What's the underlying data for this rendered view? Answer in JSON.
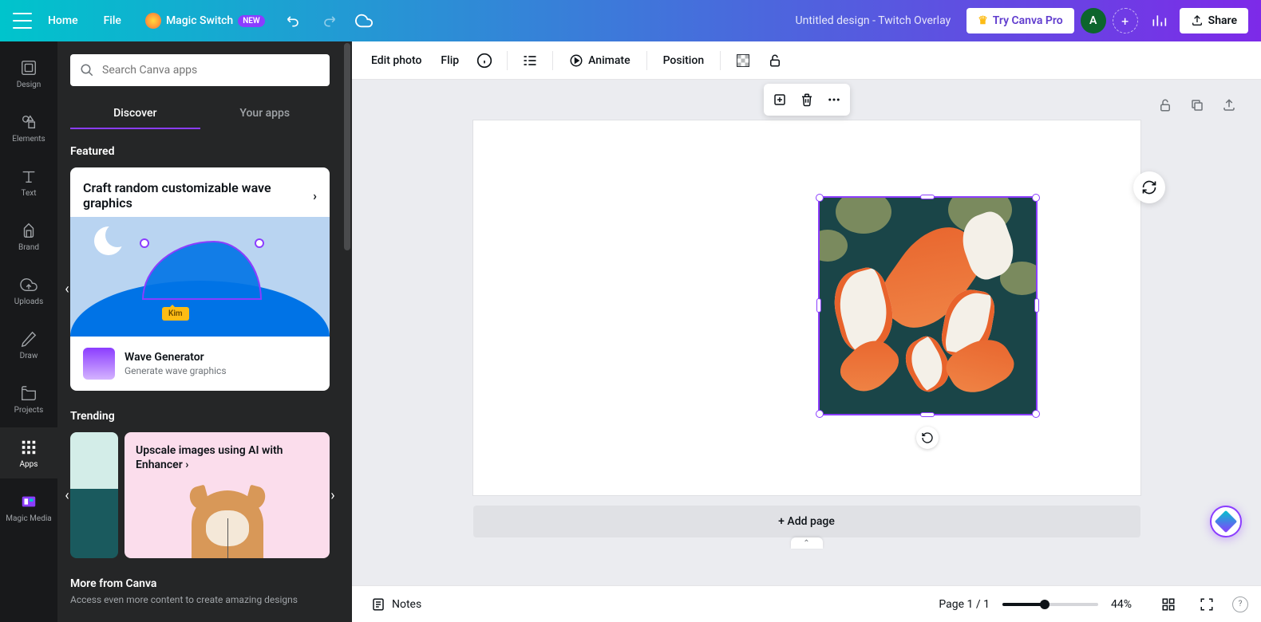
{
  "header": {
    "home": "Home",
    "file": "File",
    "magic_switch": "Magic Switch",
    "new_badge": "NEW",
    "design_title": "Untitled design - Twitch Overlay",
    "try_pro": "Try Canva Pro",
    "avatar_letter": "A",
    "share": "Share"
  },
  "rail": {
    "design": "Design",
    "elements": "Elements",
    "text": "Text",
    "brand": "Brand",
    "uploads": "Uploads",
    "draw": "Draw",
    "projects": "Projects",
    "apps": "Apps",
    "magic_media": "Magic Media"
  },
  "panel": {
    "search_placeholder": "Search Canva apps",
    "tabs": {
      "discover": "Discover",
      "your_apps": "Your apps"
    },
    "featured_heading": "Featured",
    "featured_card": {
      "headline": "Craft random customizable wave graphics",
      "user_tag": "Kim",
      "app_name": "Wave Generator",
      "app_desc": "Generate wave graphics"
    },
    "trending_heading": "Trending",
    "trending_card": {
      "headline": "Upscale images using AI with Enhancer"
    },
    "more_heading": "More from Canva",
    "more_desc": "Access even more content to create amazing designs"
  },
  "toolbar": {
    "edit_photo": "Edit photo",
    "flip": "Flip",
    "animate": "Animate",
    "position": "Position"
  },
  "canvas": {
    "add_page": "+ Add page"
  },
  "footer": {
    "notes": "Notes",
    "page_indicator": "Page 1 / 1",
    "zoom_pct": "44%"
  }
}
